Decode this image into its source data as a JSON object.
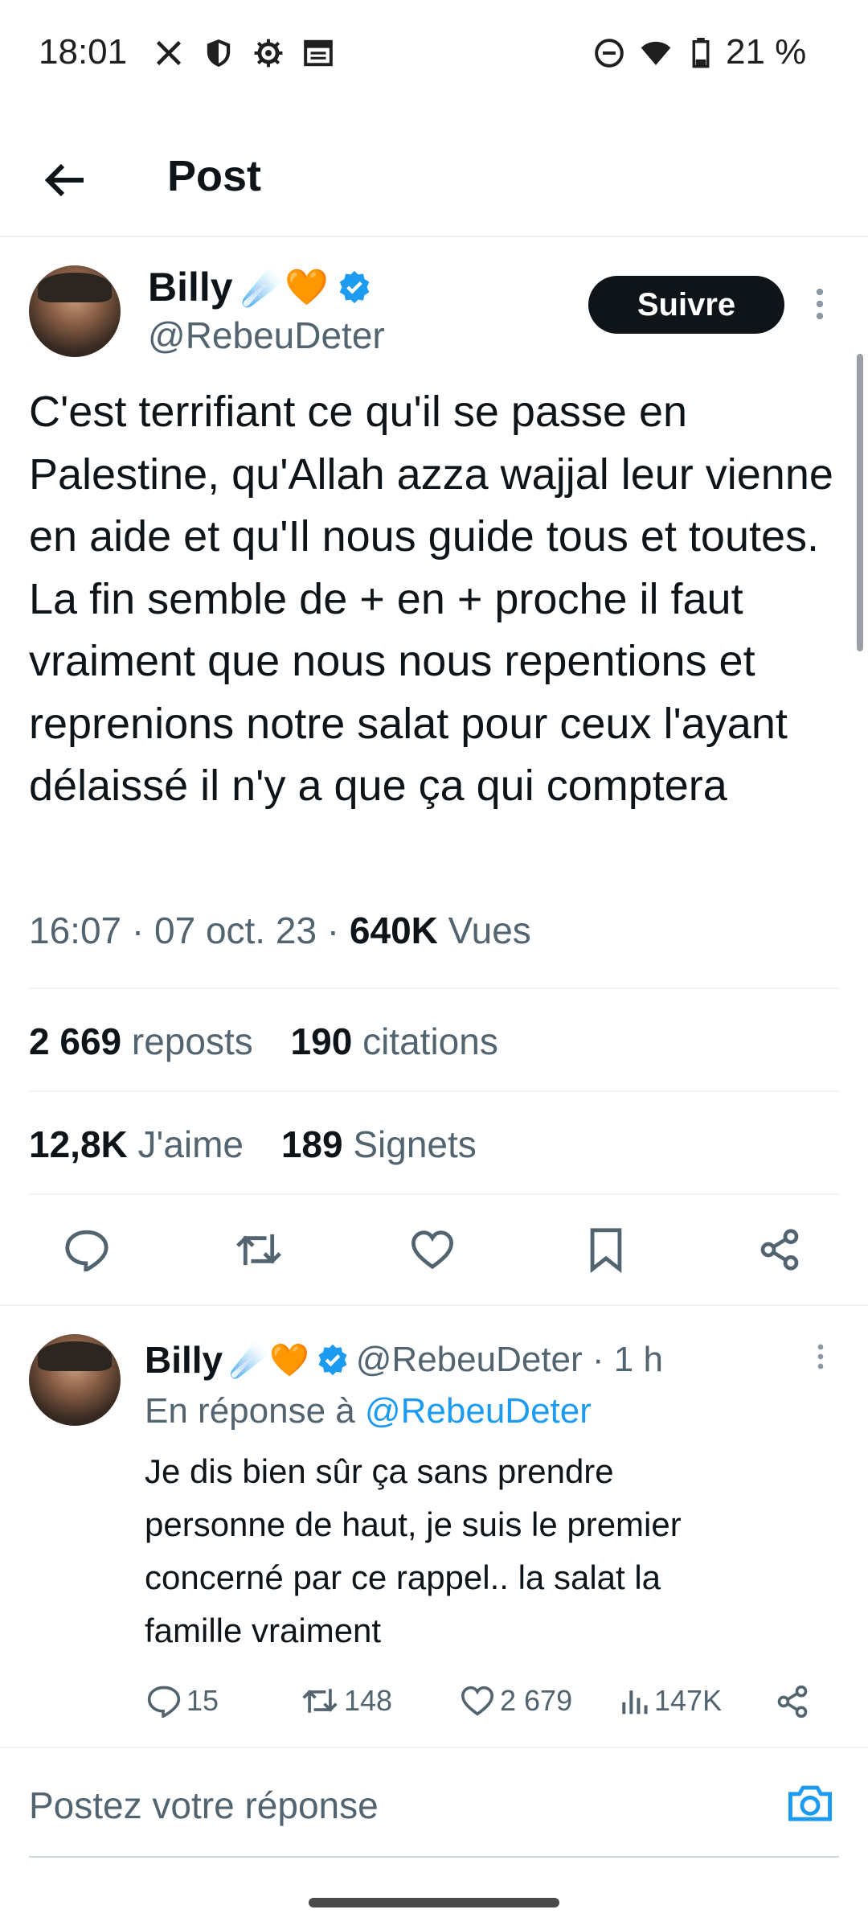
{
  "status_bar": {
    "time": "18:01",
    "battery": "21 %",
    "icons": [
      "x-logo-icon",
      "shield-icon",
      "gear-icon",
      "calendar-icon",
      "do-not-disturb-icon",
      "wifi-icon",
      "battery-icon"
    ]
  },
  "header": {
    "title": "Post",
    "back_icon": "arrow-left-icon"
  },
  "post": {
    "author_name": "Billy",
    "author_emojis": "☄️🧡",
    "handle": "@RebeuDeter",
    "follow_label": "Suivre",
    "text": "C'est terrifiant ce qu'il se passe en Palestine, qu'Allah azza wajjal leur vienne en aide et qu'Il nous guide tous et toutes. La fin semble de + en + proche il faut vraiment que nous nous repentions et reprenions notre salat pour ceux l'ayant délaissé il n'y a que ça qui comptera",
    "meta_time": "16:07 · 07 oct. 23 · ",
    "views_count": "640K",
    "views_label": "Vues",
    "reposts_count": "2 669",
    "reposts_label": "reposts",
    "quotes_count": "190",
    "quotes_label": "citations",
    "likes_count": "12,8K",
    "likes_label": "J'aime",
    "bookmarks_count": "189",
    "bookmarks_label": "Signets"
  },
  "reply": {
    "author_name": "Billy",
    "author_emojis": "☄️🧡",
    "handle_time": "@RebeuDeter · 1 h",
    "in_reply_prefix": "En réponse à ",
    "in_reply_handle": "@RebeuDeter",
    "text_lines": [
      "Je dis bien sûr ça sans prendre",
      "personne de haut, je suis le premier",
      "concerné par ce rappel.. la salat la",
      "famille vraiment"
    ],
    "comments": "15",
    "reposts": "148",
    "likes": "2 679",
    "views": "147K"
  },
  "compose": {
    "placeholder": "Postez votre réponse"
  },
  "colors": {
    "accent": "#1d9bf0",
    "text": "#0f1419",
    "muted": "#536471",
    "divider": "#eff3f4"
  }
}
